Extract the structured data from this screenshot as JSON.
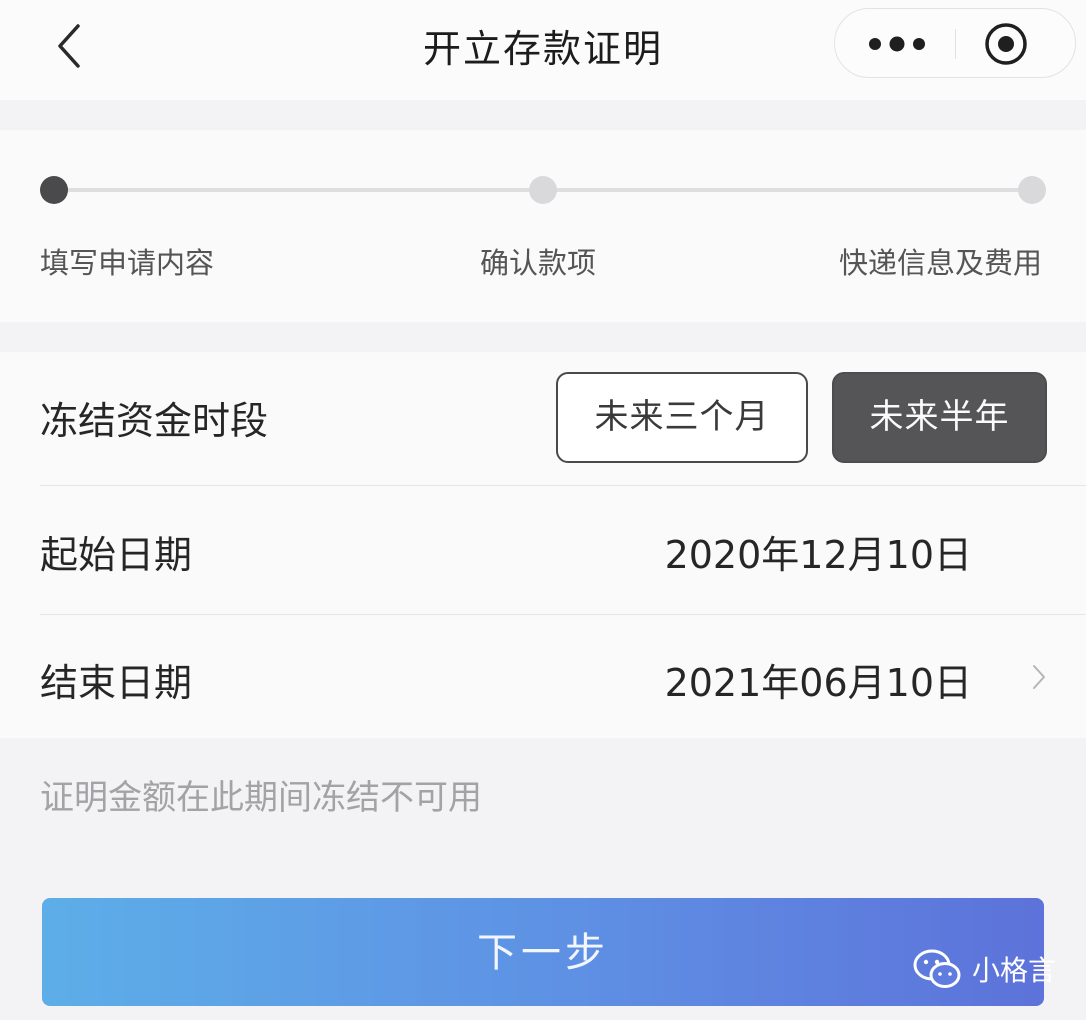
{
  "header": {
    "title": "开立存款证明",
    "back_icon": "chevron-left-icon",
    "more_icon": "more-dots-icon",
    "close_icon": "target-circle-icon"
  },
  "steps": [
    {
      "label": "填写申请内容",
      "active": true
    },
    {
      "label": "确认款项",
      "active": false
    },
    {
      "label": "快递信息及费用",
      "active": false
    }
  ],
  "freeze": {
    "label": "冻结资金时段",
    "options": [
      "未来三个月",
      "未来半年"
    ],
    "selected": "未来半年"
  },
  "start_date": {
    "label": "起始日期",
    "value": "2020年12月10日"
  },
  "end_date": {
    "label": "结束日期",
    "value": "2021年06月10日"
  },
  "note": "证明金额在此期间冻结不可用",
  "next_button": "下一步",
  "watermark": {
    "text": "小格言",
    "icon": "wechat-icon"
  },
  "colors": {
    "accent_start": "#5daee8",
    "accent_end": "#5d72da",
    "selected_option": "#555557"
  }
}
